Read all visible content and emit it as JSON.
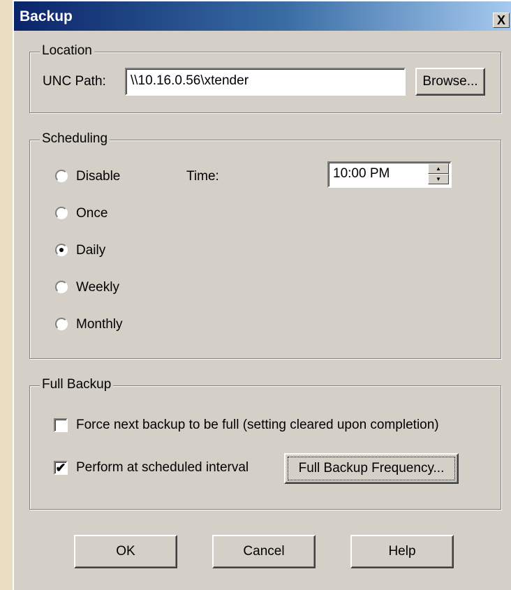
{
  "window": {
    "title": "Backup",
    "close_glyph": "X"
  },
  "location": {
    "legend": "Location",
    "unc_label": "UNC Path:",
    "unc_value": "\\\\10.16.0.56\\xtender",
    "browse_label": "Browse..."
  },
  "scheduling": {
    "legend": "Scheduling",
    "options": [
      {
        "label": "Disable",
        "selected": false
      },
      {
        "label": "Once",
        "selected": false
      },
      {
        "label": "Daily",
        "selected": true
      },
      {
        "label": "Weekly",
        "selected": false
      },
      {
        "label": "Monthly",
        "selected": false
      }
    ],
    "time_label": "Time:",
    "time_value": "10:00 PM"
  },
  "full_backup": {
    "legend": "Full Backup",
    "force_label": "Force next backup to be full  (setting cleared upon completion)",
    "force_checked": false,
    "perform_label": "Perform at scheduled interval",
    "perform_checked": true,
    "frequency_button": "Full Backup Frequency..."
  },
  "buttons": {
    "ok": "OK",
    "cancel": "Cancel",
    "help": "Help"
  },
  "colors": {
    "title_start": "#0a246a",
    "title_end": "#a6caf0",
    "face": "#d4d0c8",
    "desktop": "#e9dcc0"
  },
  "icons": {
    "close": "close-icon",
    "spin_up": "spin-up-icon",
    "spin_down": "spin-down-icon",
    "checkmark": "checkmark-icon"
  }
}
